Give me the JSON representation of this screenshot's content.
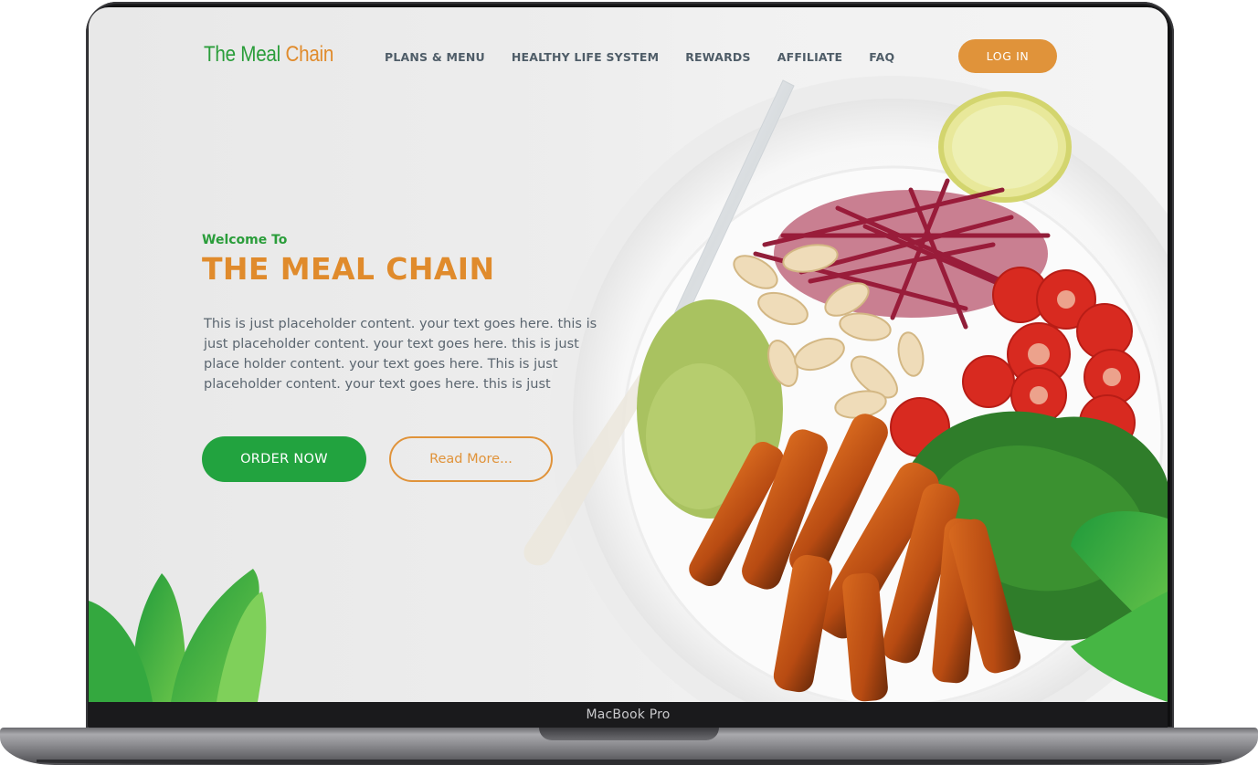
{
  "brand": {
    "name_part1": "The Meal",
    "name_part2": "Chain"
  },
  "nav": {
    "items": [
      {
        "label": "PLANS & MENU"
      },
      {
        "label": "HEALTHY LIFE SYSTEM"
      },
      {
        "label": "REWARDS"
      },
      {
        "label": "AFFILIATE"
      },
      {
        "label": "FAQ"
      }
    ],
    "login_label": "LOG IN"
  },
  "hero": {
    "welcome": "Welcome To",
    "title": "THE MEAL CHAIN",
    "body": "This is just placeholder content. your text goes here. this is just placeholder content. your text goes here. this is just place holder content. your text goes here. This is just placeholder content. your text goes here. this is just",
    "order_label": "ORDER NOW",
    "read_more_label": "Read More..."
  },
  "device": {
    "label": "MacBook Pro"
  },
  "colors": {
    "brand_green": "#2a9d3a",
    "brand_orange": "#e08b2c",
    "button_green": "#22a33f",
    "nav_text": "#4f5d68"
  }
}
